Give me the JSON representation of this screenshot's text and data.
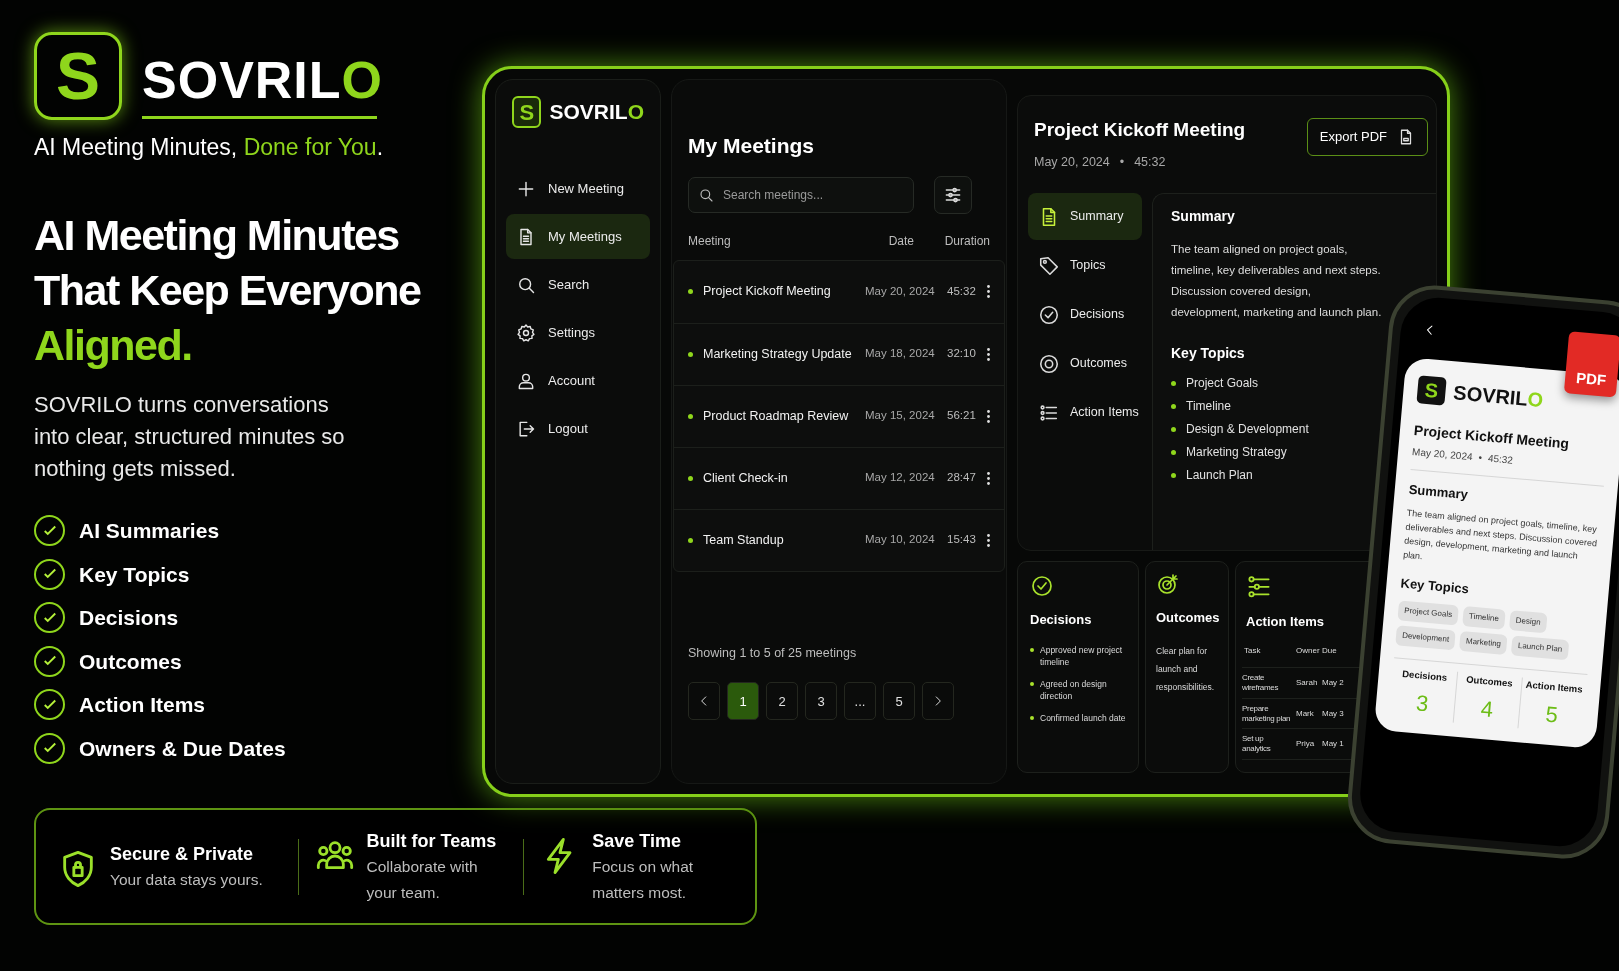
{
  "hero": {
    "logo_letter": "S",
    "brand": [
      {
        "text": "SOVRIL",
        "accent": false
      },
      {
        "text": "O",
        "accent": true
      }
    ],
    "tagline": [
      {
        "text": "AI Meeting Minutes, ",
        "accent": false
      },
      {
        "text": "Done for You",
        "accent": true
      },
      {
        "text": ".",
        "accent": false
      }
    ],
    "headline": [
      {
        "text": "AI Meeting Minutes",
        "accent": false
      },
      {
        "text": "That Keep Everyone",
        "accent": false
      },
      {
        "text": "Aligned.",
        "accent": true
      }
    ],
    "description": "SOVRILO turns conversations into clear, structured minutes so nothing gets missed.",
    "features": [
      {
        "label": "AI Summaries",
        "checked": true
      },
      {
        "label": "Key Topics",
        "checked": true
      },
      {
        "label": "Decisions",
        "checked": true
      },
      {
        "label": "Outcomes",
        "checked": true
      },
      {
        "label": "Action Items",
        "checked": true
      },
      {
        "label": "Owners & Due Dates",
        "checked": true
      }
    ],
    "highlights": [
      {
        "title": "Secure & Private",
        "text": "Your data stays yours."
      },
      {
        "title": "Built for Teams",
        "text": "Collaborate with your team."
      },
      {
        "title": "Save Time",
        "text": "Focus on what matters most."
      }
    ]
  },
  "app": {
    "sidebar": {
      "logo_letter": "S",
      "brand": [
        {
          "text": "SOVRIL",
          "accent": false
        },
        {
          "text": "O",
          "accent": true
        }
      ],
      "items": [
        {
          "label": "New Meeting",
          "selected": false
        },
        {
          "label": "My Meetings",
          "selected": true
        },
        {
          "label": "Search",
          "selected": false
        },
        {
          "label": "Settings",
          "selected": false
        },
        {
          "label": "Account",
          "selected": false
        },
        {
          "label": "Logout",
          "selected": false
        }
      ]
    },
    "meetings": {
      "title": "My Meetings",
      "search": {
        "placeholder": "Search meetings..."
      },
      "columns": [
        "Meeting",
        "Date",
        "Duration"
      ],
      "rows": [
        {
          "name": "Project Kickoff Meeting",
          "date": "May 20, 2024",
          "duration": "45:32"
        },
        {
          "name": "Marketing Strategy Update",
          "date": "May 18, 2024",
          "duration": "32:10"
        },
        {
          "name": "Product Roadmap Review",
          "date": "May 15, 2024",
          "duration": "56:21"
        },
        {
          "name": "Client Check-in",
          "date": "May 12, 2024",
          "duration": "28:47"
        },
        {
          "name": "Team Standup",
          "date": "May 10, 2024",
          "duration": "15:43"
        }
      ],
      "summary": "Showing 1 to 5 of 25 meetings",
      "pages": [
        {
          "label": "1",
          "selected": true
        },
        {
          "label": "2",
          "selected": false
        },
        {
          "label": "3",
          "selected": false
        },
        {
          "label": "...",
          "selected": false
        },
        {
          "label": "5",
          "selected": false
        }
      ]
    },
    "detail": {
      "title": "Project Kickoff Meeting",
      "date": "May 20, 2024",
      "separator": "•",
      "duration": "45:32",
      "export_button": "Export PDF",
      "tabs": [
        {
          "label": "Summary",
          "selected": true
        },
        {
          "label": "Topics",
          "selected": false
        },
        {
          "label": "Decisions",
          "selected": false
        },
        {
          "label": "Outcomes",
          "selected": false
        },
        {
          "label": "Action Items",
          "selected": false
        }
      ],
      "summary_heading": "Summary",
      "summary_text": "The team aligned on project goals, timeline, key deliverables and next steps. Discussion covered design, development, marketing and launch plan.",
      "key_topics_heading": "Key Topics",
      "key_topics": [
        "Project Goals",
        "Timeline",
        "Design & Development",
        "Marketing Strategy",
        "Launch Plan"
      ],
      "decisions": {
        "title": "Decisions",
        "items": [
          "Approved new project timeline",
          "Agreed on design direction",
          "Confirmed launch date"
        ]
      },
      "outcomes": {
        "title": "Outcomes",
        "text": "Clear plan for launch and responsibilities."
      },
      "action_items": {
        "title": "Action Items",
        "columns": [
          "Task",
          "Owner",
          "Due"
        ],
        "rows": [
          [
            "Create wireframes",
            "Sarah",
            "May 2"
          ],
          [
            "Prepare marketing plan",
            "Mark",
            "May 3"
          ],
          [
            "Set up analytics",
            "Priya",
            "May 1"
          ]
        ]
      }
    }
  },
  "phone": {
    "logo_letter": "S",
    "brand": [
      {
        "text": "SOVRIL",
        "accent": false
      },
      {
        "text": "O",
        "accent": true
      }
    ],
    "pdf_badge": "PDF",
    "title": "Project Kickoff Meeting",
    "date": "May 20, 2024",
    "separator": "•",
    "duration": "45:32",
    "summary_heading": "Summary",
    "summary_text": "The team aligned on project goals, timeline, key deliverables and next steps. Discussion covered design, development, marketing and launch plan.",
    "key_topics_heading": "Key Topics",
    "topics": [
      "Project Goals",
      "Timeline",
      "Design",
      "Development",
      "Marketing",
      "Launch Plan"
    ],
    "stats": [
      {
        "label": "Decisions",
        "value": "3"
      },
      {
        "label": "Outcomes",
        "value": "4"
      },
      {
        "label": "Action Items",
        "value": "5"
      }
    ]
  }
}
